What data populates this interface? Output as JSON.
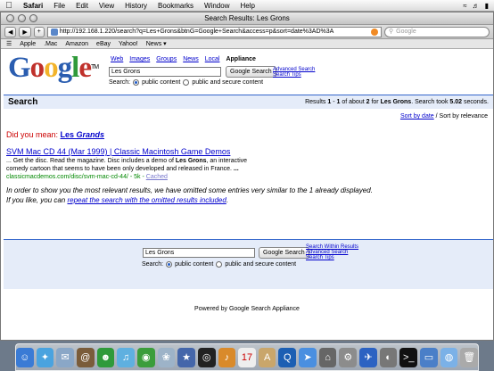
{
  "menubar": {
    "apple": "",
    "items": [
      "Safari",
      "File",
      "Edit",
      "View",
      "History",
      "Bookmarks",
      "Window",
      "Help"
    ],
    "clock_icon": "wifi-icon"
  },
  "window": {
    "title": "Search Results: Les Grons",
    "url": "http://192.168.1.220/search?q=Les+Grons&btnG=Google+Search&access=p&sort=date%3AD%3A",
    "search_placeholder": "Google",
    "bookmarks": [
      "Apple",
      ".Mac",
      "Amazon",
      "eBay",
      "Yahoo!",
      "News ▾"
    ]
  },
  "page": {
    "logo": [
      "G",
      "o",
      "o",
      "g",
      "l",
      "e"
    ],
    "logo_colors": [
      "#2a5db0",
      "#c0312b",
      "#f2b32a",
      "#2a5db0",
      "#2f9a3a",
      "#c0312b"
    ],
    "logo_tm": "TM",
    "tabs": [
      "Web",
      "Images",
      "Groups",
      "News",
      "Local",
      "Appliance"
    ],
    "query": "Les Grons",
    "search_button": "Google Search",
    "adv_links": [
      "Advanced Search",
      "Search Tips"
    ],
    "search_label": "Search:",
    "radio_public": "public content",
    "radio_secure": "public and secure content",
    "bar_label": "Search",
    "stats": {
      "p1": "Results ",
      "from": "1",
      "p2": " - ",
      "to": "1",
      "p3": " of about ",
      "total": "2",
      "p4": " for ",
      "query": "Les Grons",
      "p5": ". Search took ",
      "time": "5.02",
      "p6": " seconds."
    },
    "sort_by_date": "Sort by date",
    "sort_sep": " / Sort by relevance",
    "did_you_mean": "Did you mean: ",
    "suggest_plain": "Les ",
    "suggest_bold": "Grands",
    "result": {
      "title": "SVM Mac CD 44 (Mar 1999) | Classic Macintosh Game Demos",
      "snip1a": "... Get the disc. Read the magazine. Disc includes a demo of ",
      "snip1b": "Les Grons",
      "snip1c": ", an interactive",
      "snip2a": "comedy cartoon that seems to have been only developed and released in France. ",
      "snip2b": "...",
      "url": "classicmacdemos.com/disc/svm-mac-cd-44/ - 5k - ",
      "cached": "Cached"
    },
    "omit_line1": "In order to show you the most relevant results, we have omitted some entries very similar to the 1 already displayed.",
    "omit_line2a": "If you like, you can ",
    "omit_link": "repeat the search with the omitted results included",
    "omit_line2b": ".",
    "bottom_links": [
      "Search Within Results",
      "Advanced Search",
      "Search Tips"
    ],
    "powered": "Powered by Google Search Appliance"
  },
  "dock_icons": [
    {
      "name": "finder-icon",
      "color": "#3a7bd5",
      "glyph": "☺"
    },
    {
      "name": "safari-compass-icon",
      "color": "#4aa3df",
      "glyph": "✦"
    },
    {
      "name": "mail-icon",
      "color": "#8aa7c7",
      "glyph": "✉"
    },
    {
      "name": "address-book-icon",
      "color": "#7a5c3a",
      "glyph": "@"
    },
    {
      "name": "ichat-icon",
      "color": "#2f9a3a",
      "glyph": "☻"
    },
    {
      "name": "itunes-icon",
      "color": "#5fb0e0",
      "glyph": "♫"
    },
    {
      "name": "ichat-av-icon",
      "color": "#3b9d3b",
      "glyph": "◉"
    },
    {
      "name": "iphoto-icon",
      "color": "#9db3c8",
      "glyph": "❀"
    },
    {
      "name": "imovie-icon",
      "color": "#4466aa",
      "glyph": "★"
    },
    {
      "name": "idvd-icon",
      "color": "#222",
      "glyph": "◎"
    },
    {
      "name": "garageband-icon",
      "color": "#d98a2b",
      "glyph": "♪"
    },
    {
      "name": "ical-icon",
      "color": "#eee",
      "glyph": "17"
    },
    {
      "name": "preview-icon",
      "color": "#c9a66b",
      "glyph": "A"
    },
    {
      "name": "quicktime-icon",
      "color": "#1c5fb3",
      "glyph": "Q"
    },
    {
      "name": "safari-icon",
      "color": "#4a8fe0",
      "glyph": "➤"
    },
    {
      "name": "sherlock-icon",
      "color": "#666",
      "glyph": "⌂"
    },
    {
      "name": "system-preferences-icon",
      "color": "#8c8c8c",
      "glyph": "⚙"
    },
    {
      "name": "network-icon",
      "color": "#2c62c2",
      "glyph": "✈"
    },
    {
      "name": "disk-utility-icon",
      "color": "#777",
      "glyph": "◐"
    },
    {
      "name": "terminal-icon",
      "color": "#111",
      "glyph": ">_"
    },
    {
      "name": "folder-icon",
      "color": "#4a7fc8",
      "glyph": "▭"
    },
    {
      "name": "network-globe-icon",
      "color": "#7bb1e7",
      "glyph": "◍"
    },
    {
      "name": "trash-icon",
      "color": "#aaa",
      "glyph": "🗑"
    }
  ]
}
